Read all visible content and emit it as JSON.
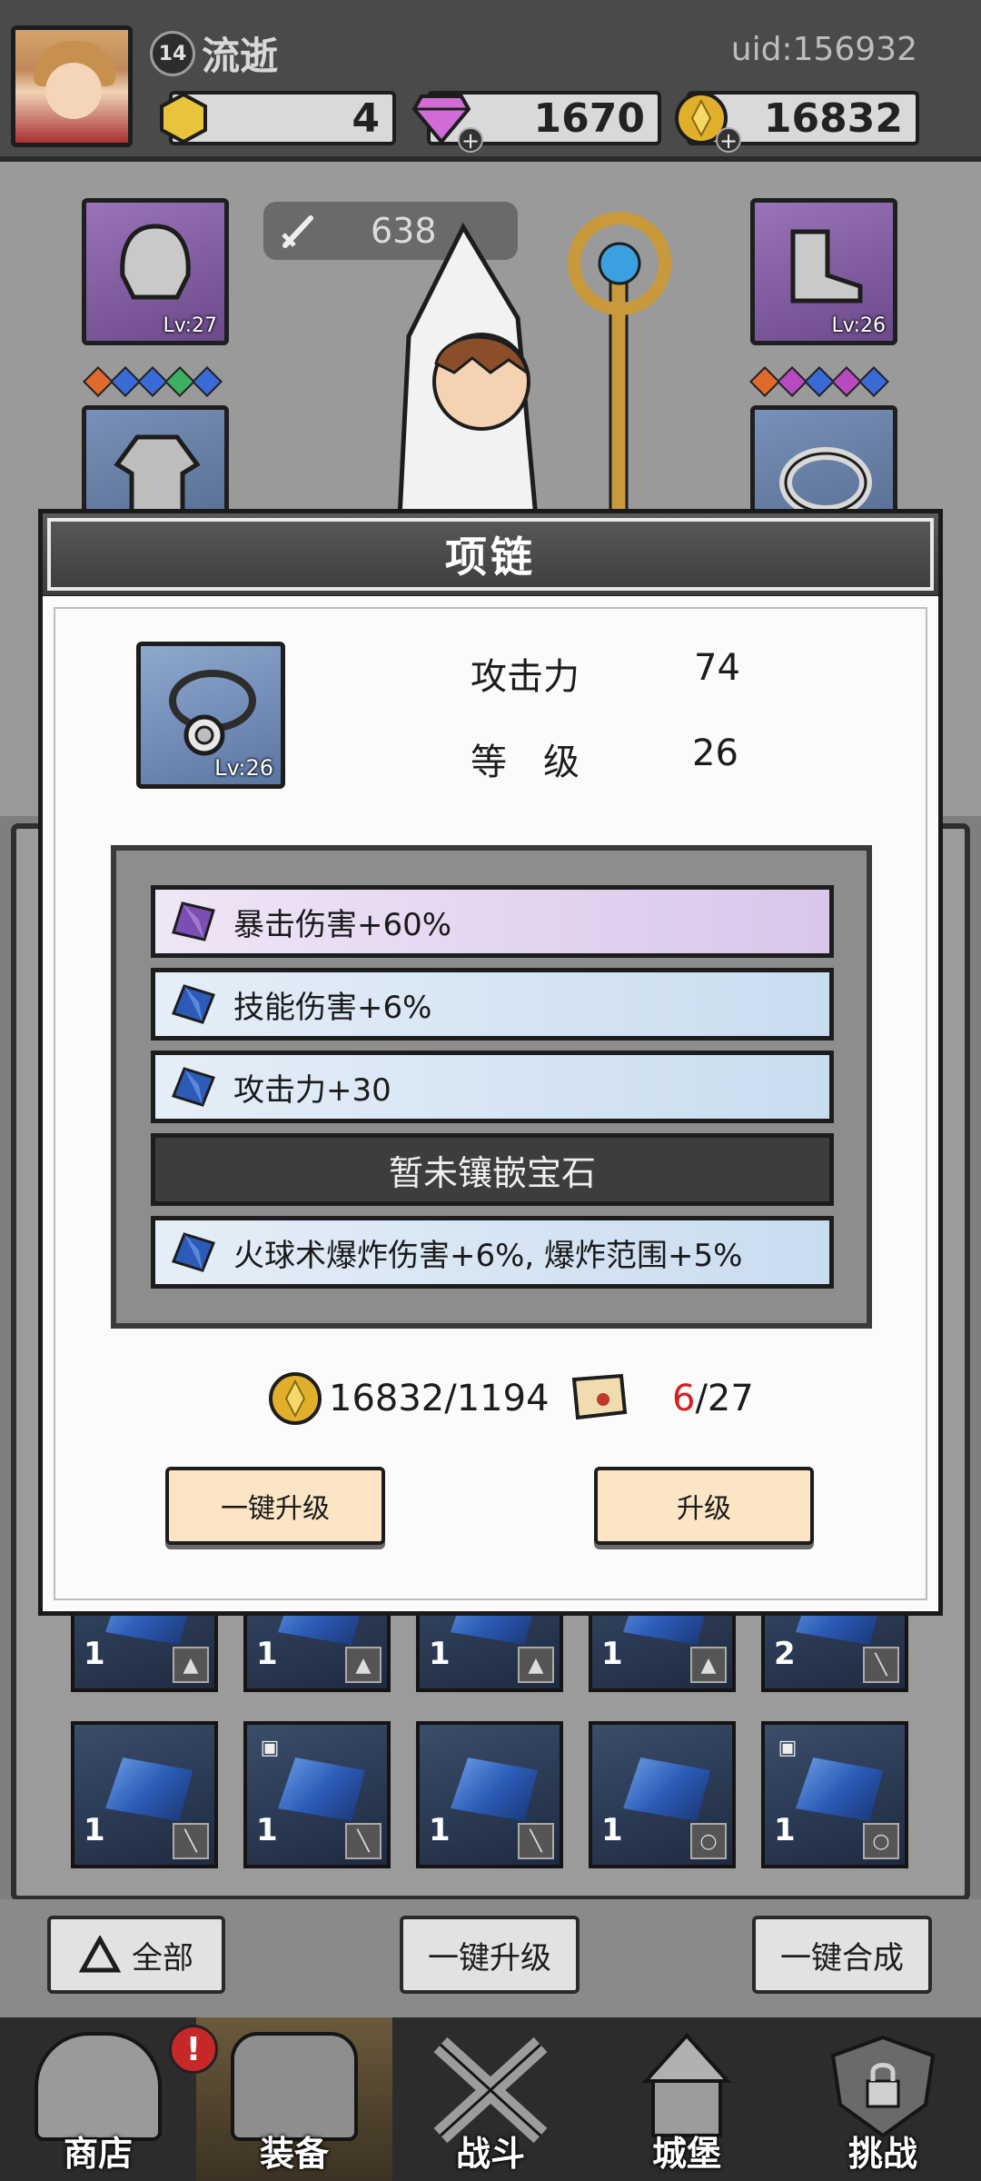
{
  "header": {
    "player_level": "14",
    "player_name": "流逝",
    "uid": "uid:156932",
    "resources": {
      "stone": "4",
      "diamond": "1670",
      "gold": "16832"
    }
  },
  "hero": {
    "power": "638",
    "equipment": {
      "helmet_level": "Lv:27",
      "boots_level": "Lv:26"
    }
  },
  "dialog": {
    "title": "项链",
    "item_level_badge": "Lv:26",
    "stats": [
      {
        "label": "攻击力",
        "value": "74"
      },
      {
        "label": "等　级",
        "value": "26"
      }
    ],
    "gems": [
      {
        "text": "暴击伤害+60%",
        "color": "purple"
      },
      {
        "text": "技能伤害+6%",
        "color": "blue"
      },
      {
        "text": "攻击力+30",
        "color": "blue"
      },
      {
        "text": "暂未镶嵌宝石",
        "color": "empty"
      },
      {
        "text": "火球术爆炸伤害+6%, 爆炸范围+5%",
        "color": "blue"
      }
    ],
    "cost": {
      "gold": "16832/1194",
      "scroll_have": "6",
      "scroll_need": "/27"
    },
    "buttons": {
      "one_click_upgrade": "一键升级",
      "upgrade": "升级"
    }
  },
  "inventory": {
    "row1_counts": [
      "1",
      "1",
      "1",
      "1",
      "2"
    ],
    "row2_counts": [
      "1",
      "1",
      "1",
      "1",
      "1"
    ]
  },
  "controls": {
    "filter_all": "全部",
    "one_click_upgrade": "一键升级",
    "one_click_merge": "一键合成"
  },
  "nav": {
    "items": [
      "商店",
      "装备",
      "战斗",
      "城堡",
      "挑战"
    ],
    "alert": "!"
  },
  "colors": {
    "accent_red": "#c62828",
    "button_peach": "#fbe5c4",
    "gem_purple": "#7a4fb5",
    "gem_blue": "#2c5cb8"
  }
}
